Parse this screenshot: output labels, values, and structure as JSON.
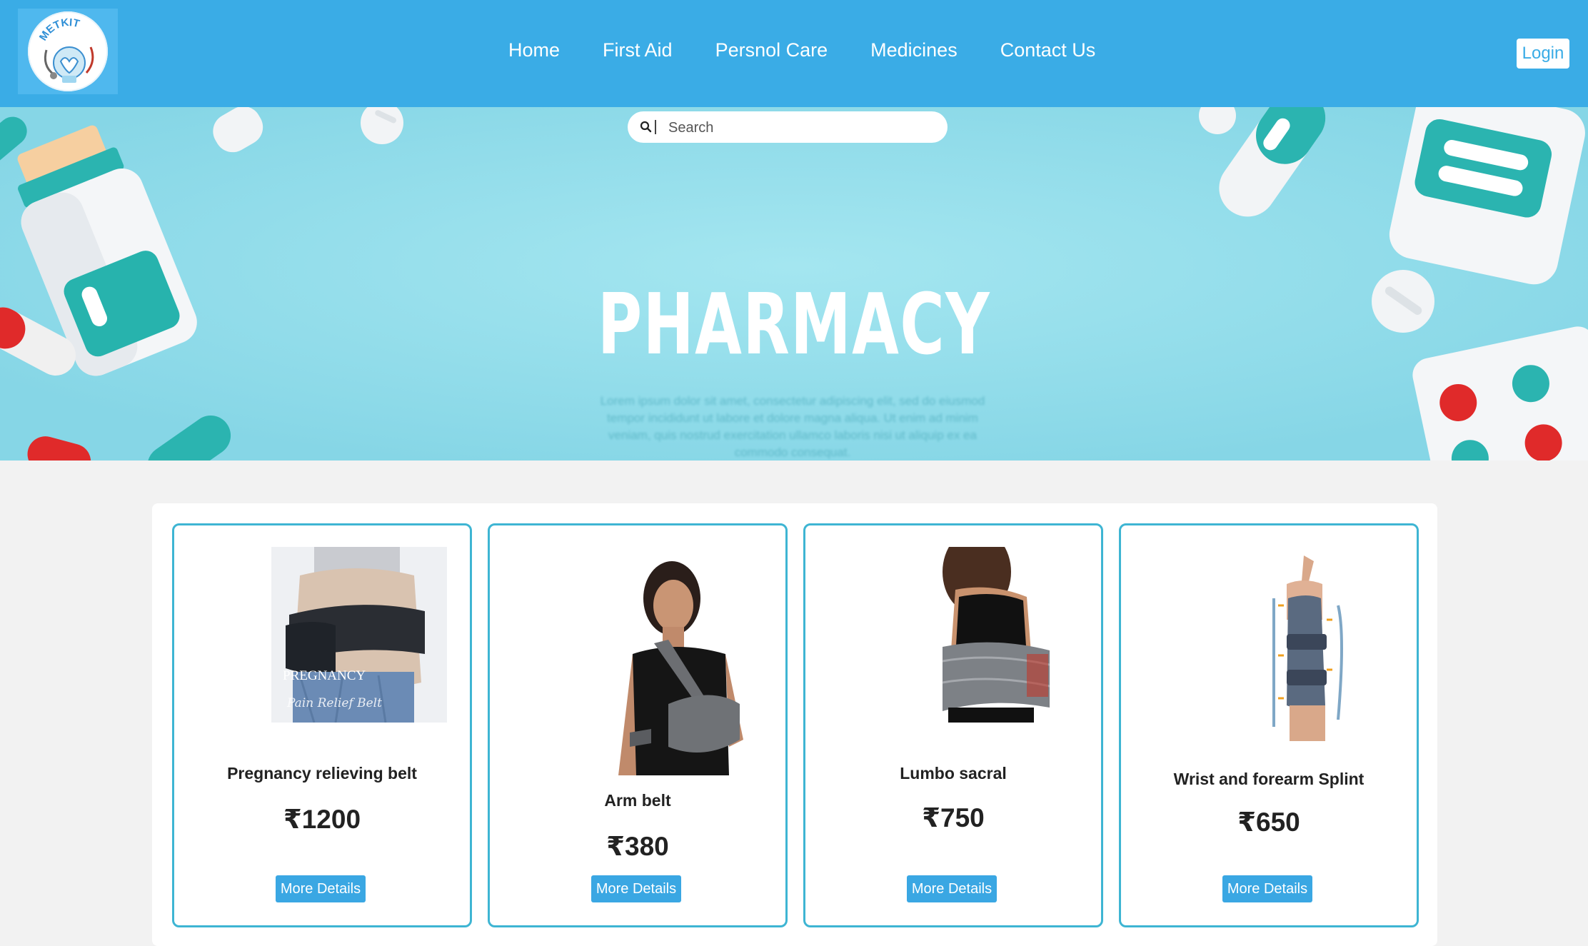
{
  "navbar": {
    "logo_text": "METKIT",
    "links": [
      {
        "label": "Home"
      },
      {
        "label": "First Aid"
      },
      {
        "label": "Persnol Care"
      },
      {
        "label": "Medicines"
      },
      {
        "label": "Contact Us"
      }
    ],
    "login_label": "Login"
  },
  "search": {
    "placeholder": "Search",
    "icon": "search-icon"
  },
  "hero": {
    "title": "PHARMACY",
    "lorem": "Lorem ipsum dolor sit amet, consectetur adipiscing elit, sed do eiusmod tempor incididunt ut labore et dolore magna aliqua. Ut enim ad minim veniam, quis nostrud exercitation ullamco laboris nisi ut aliquip ex ea commodo consequat."
  },
  "products": [
    {
      "name": "Pregnancy relieving belt",
      "price": "₹1200",
      "button": "More Details",
      "image_caption": "PREGNANCY",
      "image_script": "Pain Relief Belt"
    },
    {
      "name": "Arm belt",
      "price": "₹380",
      "button": "More Details"
    },
    {
      "name": "Lumbo sacral",
      "price": "₹750",
      "button": "More Details"
    },
    {
      "name": "Wrist and forearm Splint",
      "price": "₹650",
      "button": "More Details"
    }
  ],
  "colors": {
    "navbar": "#3aace6",
    "hero": "#8fdbe8",
    "card_border": "#3eb5d3",
    "button": "#3aa7e3"
  }
}
